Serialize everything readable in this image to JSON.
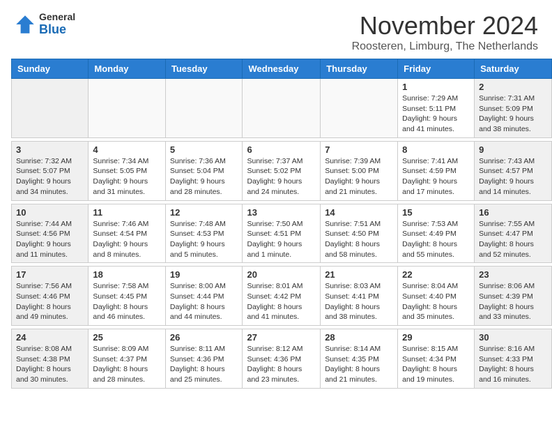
{
  "logo": {
    "general": "General",
    "blue": "Blue"
  },
  "title": "November 2024",
  "location": "Roosteren, Limburg, The Netherlands",
  "days_header": [
    "Sunday",
    "Monday",
    "Tuesday",
    "Wednesday",
    "Thursday",
    "Friday",
    "Saturday"
  ],
  "weeks": [
    {
      "days": [
        {
          "num": "",
          "info": ""
        },
        {
          "num": "",
          "info": ""
        },
        {
          "num": "",
          "info": ""
        },
        {
          "num": "",
          "info": ""
        },
        {
          "num": "",
          "info": ""
        },
        {
          "num": "1",
          "info": "Sunrise: 7:29 AM\nSunset: 5:11 PM\nDaylight: 9 hours and 41 minutes."
        },
        {
          "num": "2",
          "info": "Sunrise: 7:31 AM\nSunset: 5:09 PM\nDaylight: 9 hours and 38 minutes."
        }
      ]
    },
    {
      "days": [
        {
          "num": "3",
          "info": "Sunrise: 7:32 AM\nSunset: 5:07 PM\nDaylight: 9 hours and 34 minutes."
        },
        {
          "num": "4",
          "info": "Sunrise: 7:34 AM\nSunset: 5:05 PM\nDaylight: 9 hours and 31 minutes."
        },
        {
          "num": "5",
          "info": "Sunrise: 7:36 AM\nSunset: 5:04 PM\nDaylight: 9 hours and 28 minutes."
        },
        {
          "num": "6",
          "info": "Sunrise: 7:37 AM\nSunset: 5:02 PM\nDaylight: 9 hours and 24 minutes."
        },
        {
          "num": "7",
          "info": "Sunrise: 7:39 AM\nSunset: 5:00 PM\nDaylight: 9 hours and 21 minutes."
        },
        {
          "num": "8",
          "info": "Sunrise: 7:41 AM\nSunset: 4:59 PM\nDaylight: 9 hours and 17 minutes."
        },
        {
          "num": "9",
          "info": "Sunrise: 7:43 AM\nSunset: 4:57 PM\nDaylight: 9 hours and 14 minutes."
        }
      ]
    },
    {
      "days": [
        {
          "num": "10",
          "info": "Sunrise: 7:44 AM\nSunset: 4:56 PM\nDaylight: 9 hours and 11 minutes."
        },
        {
          "num": "11",
          "info": "Sunrise: 7:46 AM\nSunset: 4:54 PM\nDaylight: 9 hours and 8 minutes."
        },
        {
          "num": "12",
          "info": "Sunrise: 7:48 AM\nSunset: 4:53 PM\nDaylight: 9 hours and 5 minutes."
        },
        {
          "num": "13",
          "info": "Sunrise: 7:50 AM\nSunset: 4:51 PM\nDaylight: 9 hours and 1 minute."
        },
        {
          "num": "14",
          "info": "Sunrise: 7:51 AM\nSunset: 4:50 PM\nDaylight: 8 hours and 58 minutes."
        },
        {
          "num": "15",
          "info": "Sunrise: 7:53 AM\nSunset: 4:49 PM\nDaylight: 8 hours and 55 minutes."
        },
        {
          "num": "16",
          "info": "Sunrise: 7:55 AM\nSunset: 4:47 PM\nDaylight: 8 hours and 52 minutes."
        }
      ]
    },
    {
      "days": [
        {
          "num": "17",
          "info": "Sunrise: 7:56 AM\nSunset: 4:46 PM\nDaylight: 8 hours and 49 minutes."
        },
        {
          "num": "18",
          "info": "Sunrise: 7:58 AM\nSunset: 4:45 PM\nDaylight: 8 hours and 46 minutes."
        },
        {
          "num": "19",
          "info": "Sunrise: 8:00 AM\nSunset: 4:44 PM\nDaylight: 8 hours and 44 minutes."
        },
        {
          "num": "20",
          "info": "Sunrise: 8:01 AM\nSunset: 4:42 PM\nDaylight: 8 hours and 41 minutes."
        },
        {
          "num": "21",
          "info": "Sunrise: 8:03 AM\nSunset: 4:41 PM\nDaylight: 8 hours and 38 minutes."
        },
        {
          "num": "22",
          "info": "Sunrise: 8:04 AM\nSunset: 4:40 PM\nDaylight: 8 hours and 35 minutes."
        },
        {
          "num": "23",
          "info": "Sunrise: 8:06 AM\nSunset: 4:39 PM\nDaylight: 8 hours and 33 minutes."
        }
      ]
    },
    {
      "days": [
        {
          "num": "24",
          "info": "Sunrise: 8:08 AM\nSunset: 4:38 PM\nDaylight: 8 hours and 30 minutes."
        },
        {
          "num": "25",
          "info": "Sunrise: 8:09 AM\nSunset: 4:37 PM\nDaylight: 8 hours and 28 minutes."
        },
        {
          "num": "26",
          "info": "Sunrise: 8:11 AM\nSunset: 4:36 PM\nDaylight: 8 hours and 25 minutes."
        },
        {
          "num": "27",
          "info": "Sunrise: 8:12 AM\nSunset: 4:36 PM\nDaylight: 8 hours and 23 minutes."
        },
        {
          "num": "28",
          "info": "Sunrise: 8:14 AM\nSunset: 4:35 PM\nDaylight: 8 hours and 21 minutes."
        },
        {
          "num": "29",
          "info": "Sunrise: 8:15 AM\nSunset: 4:34 PM\nDaylight: 8 hours and 19 minutes."
        },
        {
          "num": "30",
          "info": "Sunrise: 8:16 AM\nSunset: 4:33 PM\nDaylight: 8 hours and 16 minutes."
        }
      ]
    }
  ]
}
